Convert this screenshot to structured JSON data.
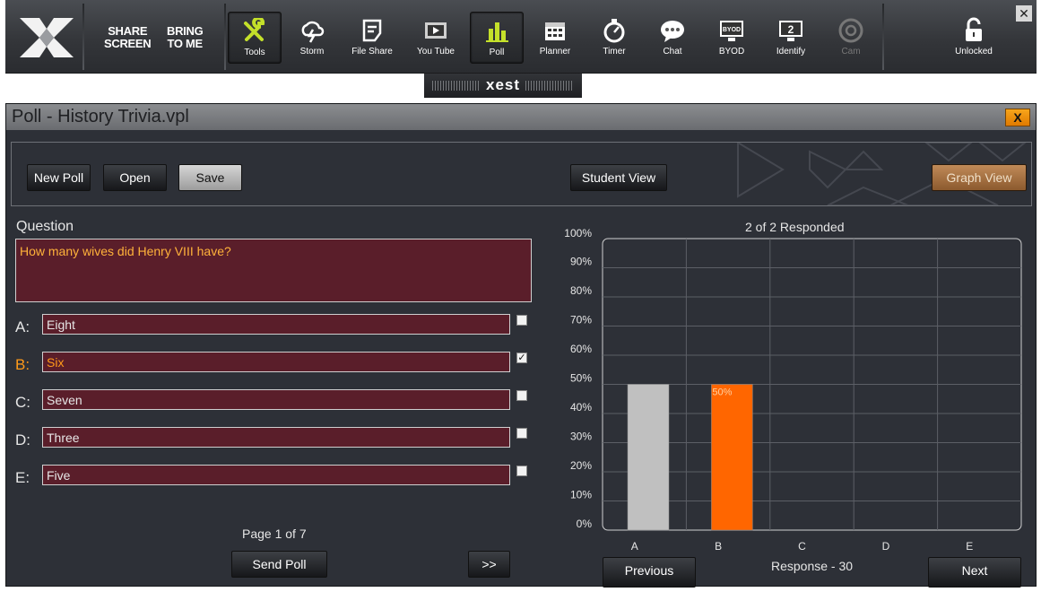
{
  "toolbar": {
    "share_screen": [
      "SHARE",
      "SCREEN"
    ],
    "bring_to_me": [
      "BRING",
      "TO ME"
    ],
    "tools": [
      {
        "label": "Tools",
        "icon": "wrench-screwdriver-icon",
        "active": true
      },
      {
        "label": "Storm",
        "icon": "cloud-lightning-icon"
      },
      {
        "label": "File Share",
        "icon": "file-share-icon"
      },
      {
        "label": "You Tube",
        "icon": "youtube-icon"
      },
      {
        "label": "Poll",
        "icon": "bar-chart-icon",
        "active": true
      },
      {
        "label": "Planner",
        "icon": "calendar-icon"
      },
      {
        "label": "Timer",
        "icon": "stopwatch-icon"
      },
      {
        "label": "Chat",
        "icon": "chat-bubble-icon"
      },
      {
        "label": "BYOD",
        "icon": "byod-monitor-icon"
      },
      {
        "label": "Identify",
        "icon": "identify-monitor-icon"
      },
      {
        "label": "Cam",
        "icon": "camera-icon",
        "disabled": true
      }
    ],
    "unlocked_label": "Unlocked",
    "close_label": "✕",
    "brand": "xest",
    "accent_color": "#c4e02a"
  },
  "window": {
    "title": "Poll - History Trivia.vpl",
    "close_label": "X",
    "buttons": {
      "new_poll": "New Poll",
      "open": "Open",
      "save": "Save",
      "student_view": "Student View",
      "graph_view": "Graph View"
    },
    "question_label": "Question",
    "question": "How many wives did Henry VIII have?",
    "answers": [
      {
        "letter": "A:",
        "text": "Eight",
        "checked": false
      },
      {
        "letter": "B:",
        "text": "Six",
        "checked": true
      },
      {
        "letter": "C:",
        "text": "Seven",
        "checked": false
      },
      {
        "letter": "D:",
        "text": "Three",
        "checked": false
      },
      {
        "letter": "E:",
        "text": "Five",
        "checked": false
      }
    ],
    "page_indicator": "Page 1 of 7",
    "send_poll": "Send Poll",
    "next_page": ">>",
    "responded": "2 of 2 Responded",
    "response_indicator": "Response - 30",
    "previous": "Previous",
    "next": "Next"
  },
  "chart_data": {
    "type": "bar",
    "categories": [
      "A",
      "B",
      "C",
      "D",
      "E"
    ],
    "values": [
      50,
      50,
      0,
      0,
      0
    ],
    "value_labels": [
      "",
      "50%",
      "",
      "",
      ""
    ],
    "bar_colors": [
      "#c0c0c0",
      "#ff6600",
      "#c0c0c0",
      "#c0c0c0",
      "#c0c0c0"
    ],
    "y_ticks": [
      "0%",
      "10%",
      "20%",
      "30%",
      "40%",
      "50%",
      "60%",
      "70%",
      "80%",
      "90%",
      "100%"
    ],
    "ylim": [
      0,
      100
    ],
    "grid": true
  }
}
